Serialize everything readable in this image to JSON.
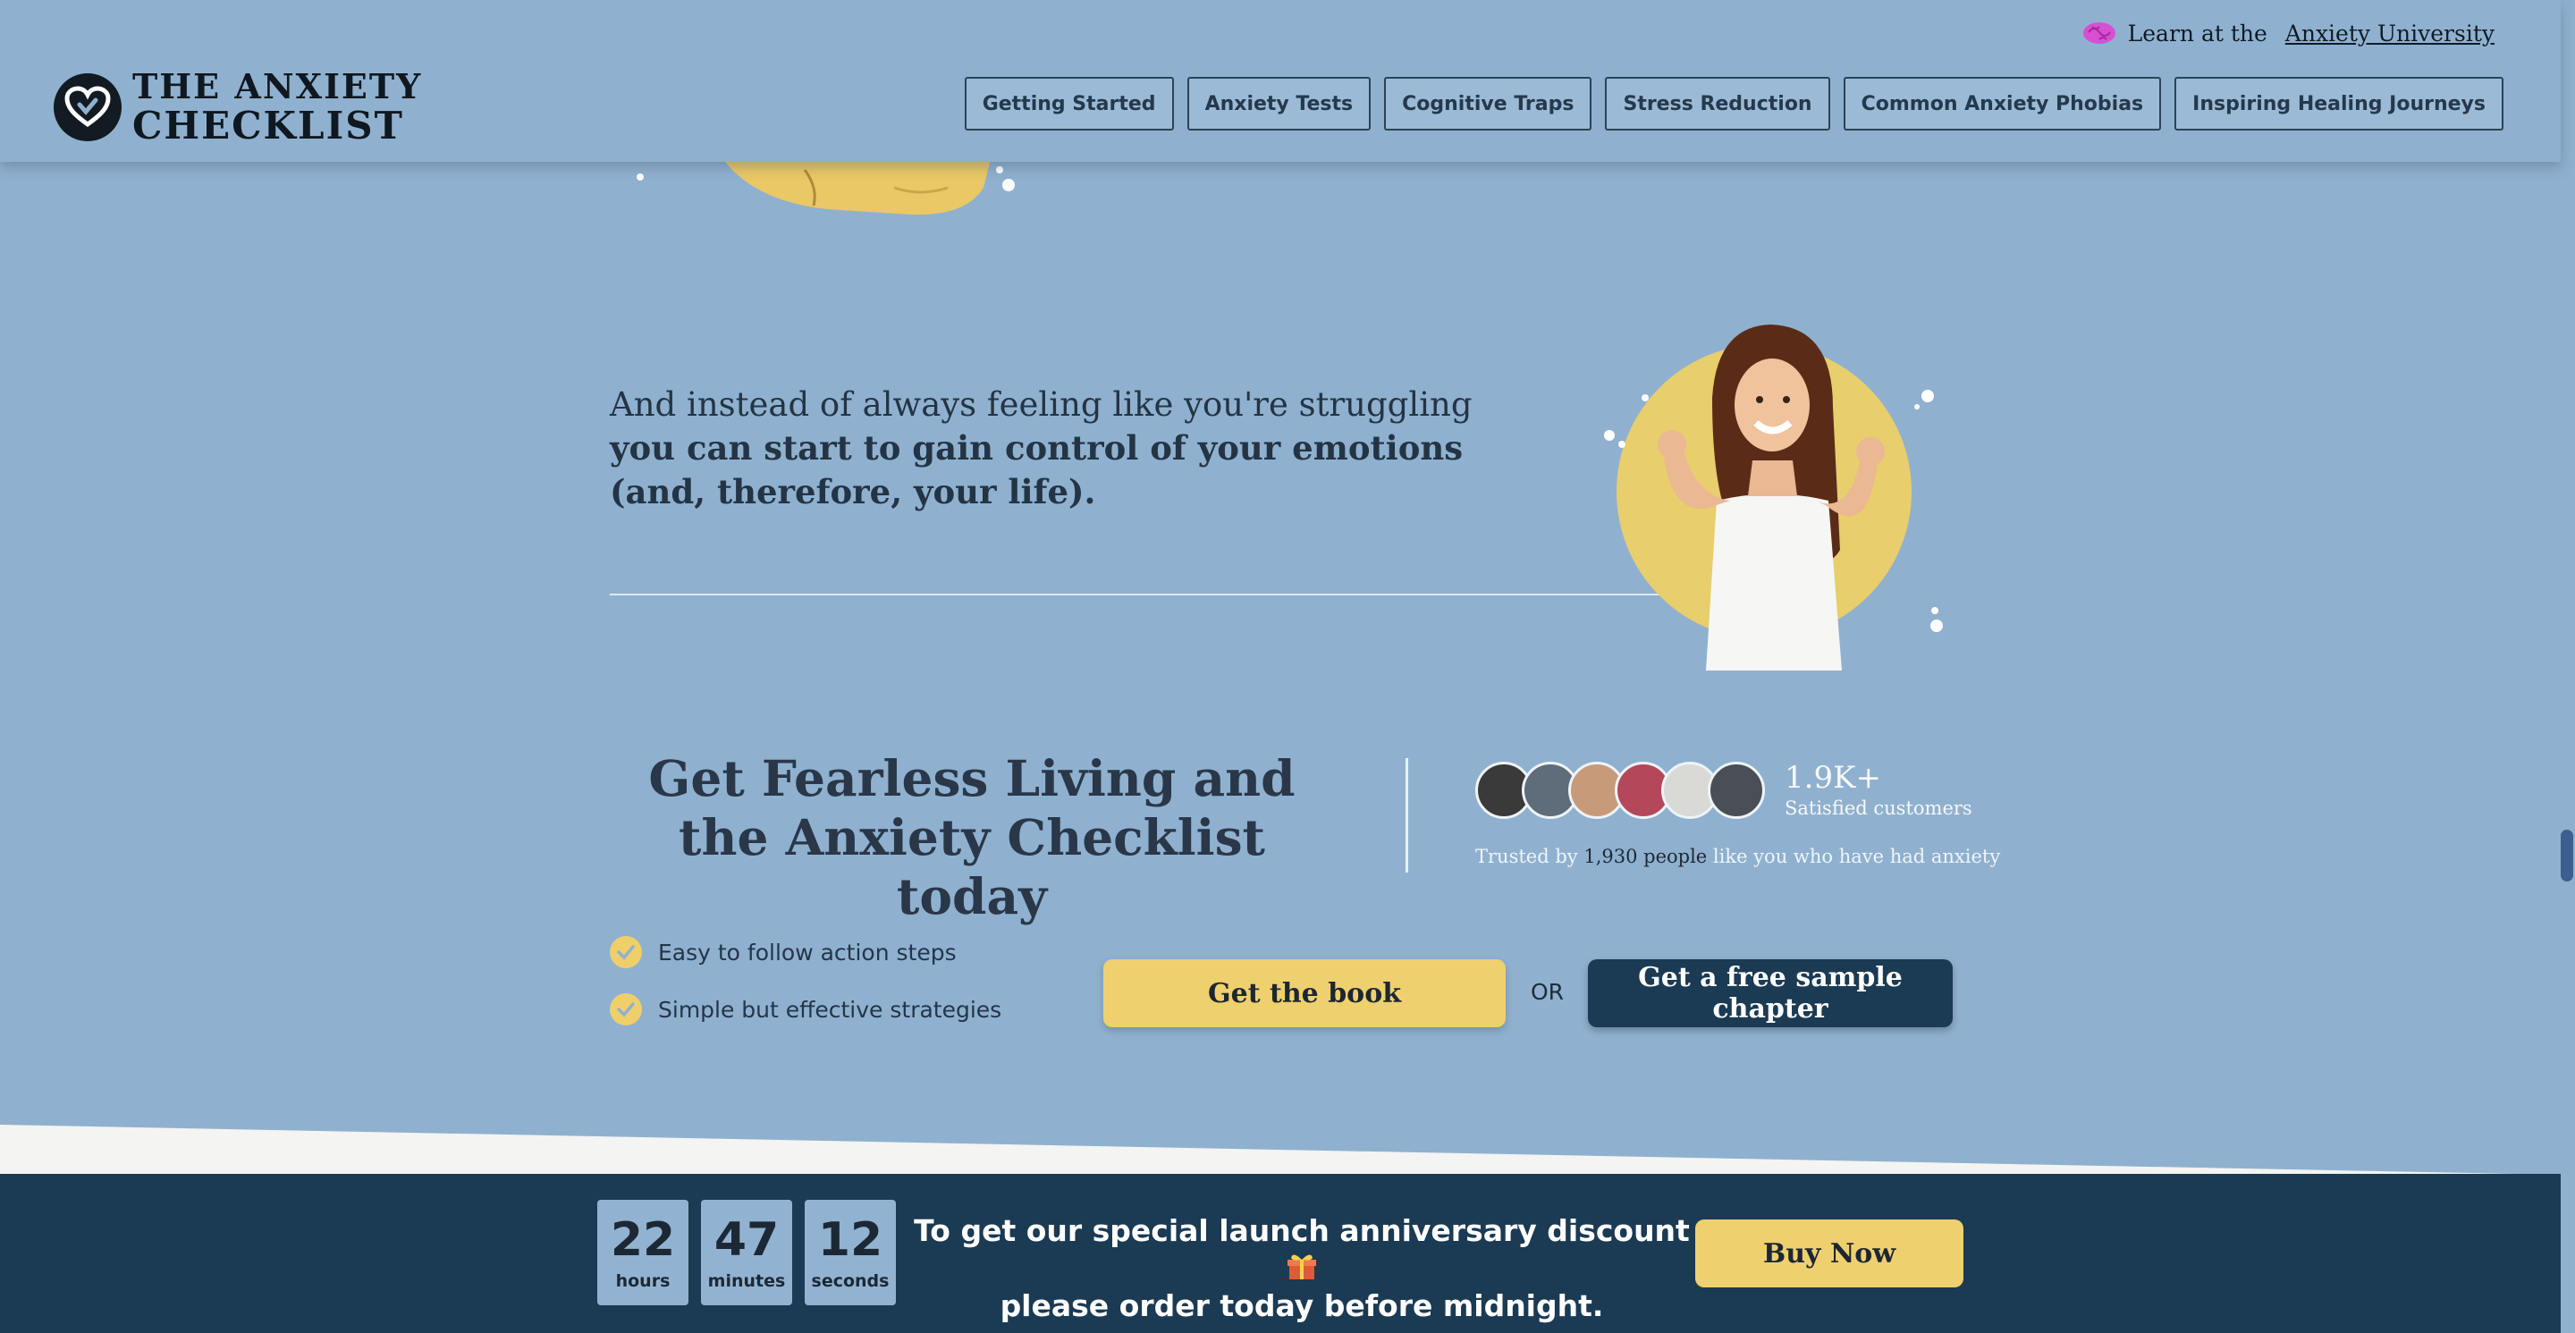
{
  "header": {
    "top_link_prefix": "Learn at the",
    "top_link_text": "Anxiety University",
    "logo_line1": "THE ANXIETY",
    "logo_line2": "CHECKLIST",
    "nav": [
      {
        "label": "Getting Started"
      },
      {
        "label": "Anxiety Tests"
      },
      {
        "label": "Cognitive Traps"
      },
      {
        "label": "Stress Reduction"
      },
      {
        "label": "Common Anxiety Phobias"
      },
      {
        "label": "Inspiring Healing Journeys"
      }
    ]
  },
  "lead": {
    "plain": "And instead of always feeling like you're struggling ",
    "bold": "you can start to gain control of your emotions (and, therefore, your life)."
  },
  "cta": {
    "title": "Get Fearless Living and the Anxiety Checklist today",
    "customer_count": "1.9K+",
    "customer_label": "Satisfied customers",
    "trusted_prefix": "Trusted by",
    "trusted_strong": "1,930 people",
    "trusted_suffix": "like you who have had anxiety",
    "checklist": [
      "Easy to follow action steps",
      "Simple but effective strategies"
    ],
    "book_button": "Get the book",
    "or_text": "OR",
    "sample_button": "Get a free sample chapter"
  },
  "countdown": {
    "hours": "22",
    "hours_label": "hours",
    "minutes": "47",
    "minutes_label": "minutes",
    "seconds": "12",
    "seconds_label": "seconds",
    "message_line1": "To get our special launch anniversary discount",
    "message_line2": "please order today before midnight.",
    "buy_button": "Buy Now"
  },
  "colors": {
    "background": "#8fb1cf",
    "accent_yellow": "#efd06e",
    "navy": "#1b3a53"
  },
  "icons": [
    "brain-icon",
    "heart-logo-icon",
    "check-icon",
    "gift-icon"
  ]
}
